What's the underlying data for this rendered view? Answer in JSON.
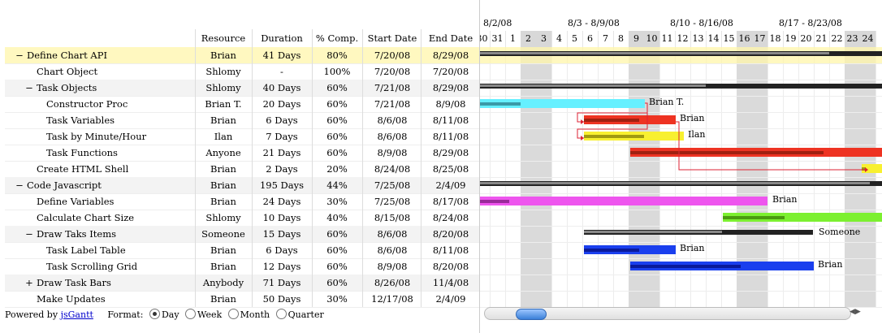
{
  "headers": {
    "resource": "Resource",
    "duration": "Duration",
    "comp": "% Comp.",
    "start": "Start Date",
    "end": "End Date"
  },
  "tasks": [
    {
      "name": "Define Chart API",
      "toggle": "−",
      "indent": 0,
      "resource": "Brian",
      "duration": "41 Days",
      "comp": "80%",
      "start": "7/20/08",
      "end": "8/29/08",
      "style": "hl"
    },
    {
      "name": "Chart Object",
      "toggle": "",
      "indent": 1,
      "resource": "Shlomy",
      "duration": "-",
      "comp": "100%",
      "start": "7/20/08",
      "end": "7/20/08",
      "style": ""
    },
    {
      "name": "Task Objects",
      "toggle": "−",
      "indent": 1,
      "resource": "Shlomy",
      "duration": "40 Days",
      "comp": "60%",
      "start": "7/21/08",
      "end": "8/29/08",
      "style": "grp"
    },
    {
      "name": "Constructor Proc",
      "toggle": "",
      "indent": 2,
      "resource": "Brian T.",
      "duration": "20 Days",
      "comp": "60%",
      "start": "7/21/08",
      "end": "8/9/08",
      "style": ""
    },
    {
      "name": "Task Variables",
      "toggle": "",
      "indent": 2,
      "resource": "Brian",
      "duration": "6 Days",
      "comp": "60%",
      "start": "8/6/08",
      "end": "8/11/08",
      "style": ""
    },
    {
      "name": "Task by Minute/Hour",
      "toggle": "",
      "indent": 2,
      "resource": "Ilan",
      "duration": "7 Days",
      "comp": "60%",
      "start": "8/6/08",
      "end": "8/11/08",
      "style": ""
    },
    {
      "name": "Task Functions",
      "toggle": "",
      "indent": 2,
      "resource": "Anyone",
      "duration": "21 Days",
      "comp": "60%",
      "start": "8/9/08",
      "end": "8/29/08",
      "style": ""
    },
    {
      "name": "Create HTML Shell",
      "toggle": "",
      "indent": 1,
      "resource": "Brian",
      "duration": "2 Days",
      "comp": "20%",
      "start": "8/24/08",
      "end": "8/25/08",
      "style": ""
    },
    {
      "name": "Code Javascript",
      "toggle": "−",
      "indent": 0,
      "resource": "Brian",
      "duration": "195 Days",
      "comp": "44%",
      "start": "7/25/08",
      "end": "2/4/09",
      "style": "grp"
    },
    {
      "name": "Define Variables",
      "toggle": "",
      "indent": 1,
      "resource": "Brian",
      "duration": "24 Days",
      "comp": "30%",
      "start": "7/25/08",
      "end": "8/17/08",
      "style": ""
    },
    {
      "name": "Calculate Chart Size",
      "toggle": "",
      "indent": 1,
      "resource": "Shlomy",
      "duration": "10 Days",
      "comp": "40%",
      "start": "8/15/08",
      "end": "8/24/08",
      "style": ""
    },
    {
      "name": "Draw Taks Items",
      "toggle": "−",
      "indent": 1,
      "resource": "Someone",
      "duration": "15 Days",
      "comp": "60%",
      "start": "8/6/08",
      "end": "8/20/08",
      "style": "grp"
    },
    {
      "name": "Task Label Table",
      "toggle": "",
      "indent": 2,
      "resource": "Brian",
      "duration": "6 Days",
      "comp": "60%",
      "start": "8/6/08",
      "end": "8/11/08",
      "style": ""
    },
    {
      "name": "Task Scrolling Grid",
      "toggle": "",
      "indent": 2,
      "resource": "Brian",
      "duration": "12 Days",
      "comp": "60%",
      "start": "8/9/08",
      "end": "8/20/08",
      "style": ""
    },
    {
      "name": "Draw Task Bars",
      "toggle": "+",
      "indent": 1,
      "resource": "Anybody",
      "duration": "71 Days",
      "comp": "60%",
      "start": "8/26/08",
      "end": "11/4/08",
      "style": "grp"
    },
    {
      "name": "Make Updates",
      "toggle": "",
      "indent": 1,
      "resource": "Brian",
      "duration": "50 Days",
      "comp": "30%",
      "start": "12/17/08",
      "end": "2/4/09",
      "style": ""
    }
  ],
  "footer": {
    "powered": "Powered by",
    "link": "jsGantt",
    "format": "Format:",
    "day": "Day",
    "week": "Week",
    "month": "Month",
    "quarter": "Quarter"
  },
  "months": [
    "8/2/08",
    "8/3 - 8/9/08",
    "8/10 - 8/16/08",
    "8/17 - 8/23/08"
  ],
  "days": [
    "30",
    "31",
    "1",
    "2",
    "3",
    "4",
    "5",
    "6",
    "7",
    "8",
    "9",
    "10",
    "11",
    "12",
    "13",
    "14",
    "15",
    "16",
    "17",
    "18",
    "19",
    "20",
    "21",
    "22",
    "23",
    "24"
  ],
  "weekend_days": [
    "2",
    "3",
    "9",
    "10",
    "16",
    "17",
    "23",
    "24"
  ],
  "bar_labels": {
    "constructor": "Brian T.",
    "taskvars": "Brian",
    "minute": "Ilan",
    "definevars": "Brian",
    "drawitems": "Someone",
    "labeltable": "Brian",
    "scrollgrid": "Brian"
  },
  "colors": {
    "cyan": "#66f0ff",
    "red": "#ee3322",
    "yellow": "#f8f030",
    "magenta": "#ee55ee",
    "green": "#7cf030",
    "blue": "#1a3fee",
    "group": "#222222",
    "highlight": "#fff8c0"
  }
}
